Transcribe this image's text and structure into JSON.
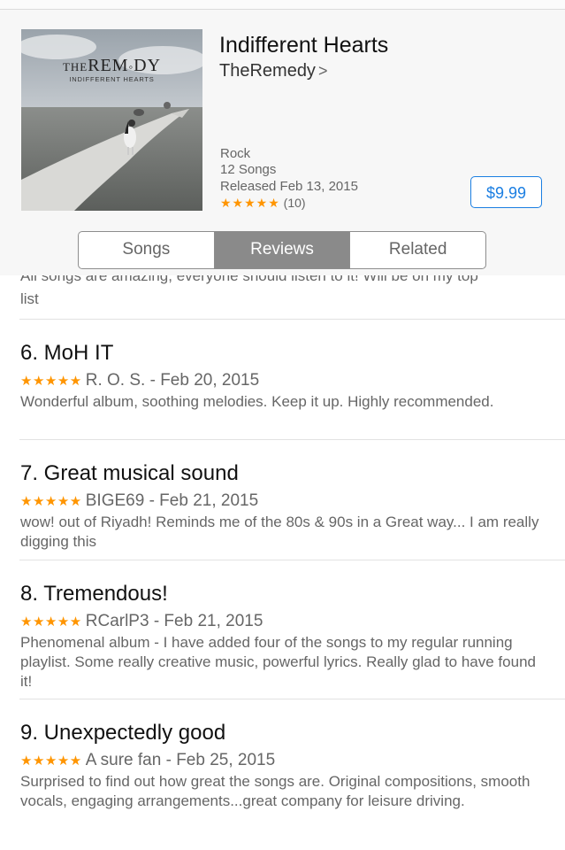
{
  "album": {
    "art_title_the": "THE",
    "art_title_main": "REM",
    "art_title_mid": "◦",
    "art_title_end": "DY",
    "art_subtitle": "INDIFFERENT HEARTS",
    "title": "Indifferent Hearts",
    "artist": "TheRemedy",
    "artist_chevron": ">",
    "genre": "Rock",
    "song_count": "12 Songs",
    "released": "Released Feb 13, 2015",
    "rating_stars": "★★★★★",
    "rating_count": "(10)",
    "price": "$9.99"
  },
  "tabs": [
    {
      "label": "Songs",
      "active": false
    },
    {
      "label": "Reviews",
      "active": true
    },
    {
      "label": "Related",
      "active": false
    }
  ],
  "partial_review": {
    "line1": "All songs are amazing, everyone should listen to it! Will be on my top",
    "line2": "list"
  },
  "reviews": [
    {
      "title": "6. MoH IT",
      "stars": "★★★★★",
      "byline": "R. O. S. - Feb 20, 2015",
      "body": "Wonderful album, soothing melodies.  Keep it up.  Highly recommended."
    },
    {
      "title": "7. Great musical sound",
      "stars": "★★★★★",
      "byline": "BIGE69 - Feb 21, 2015",
      "body": "wow! out of Riyadh! Reminds me of the 80s & 90s in a Great way... I am really digging this"
    },
    {
      "title": "8. Tremendous!",
      "stars": "★★★★★",
      "byline": "RCarlP3 - Feb 21, 2015",
      "body": "Phenomenal album - I have added four of the songs to my regular running playlist.  Some really creative music, powerful lyrics.  Really glad to have found it!"
    },
    {
      "title": "9. Unexpectedly good",
      "stars": "★★★★★",
      "byline": "A sure fan - Feb 25, 2015",
      "body": "Surprised to find out how great the songs are. Original compositions, smooth vocals, engaging arrangements...great company for leisure driving."
    }
  ],
  "colors": {
    "accent": "#1a7ee2",
    "star": "#ff9500",
    "segment_active": "#8a8a8a"
  }
}
